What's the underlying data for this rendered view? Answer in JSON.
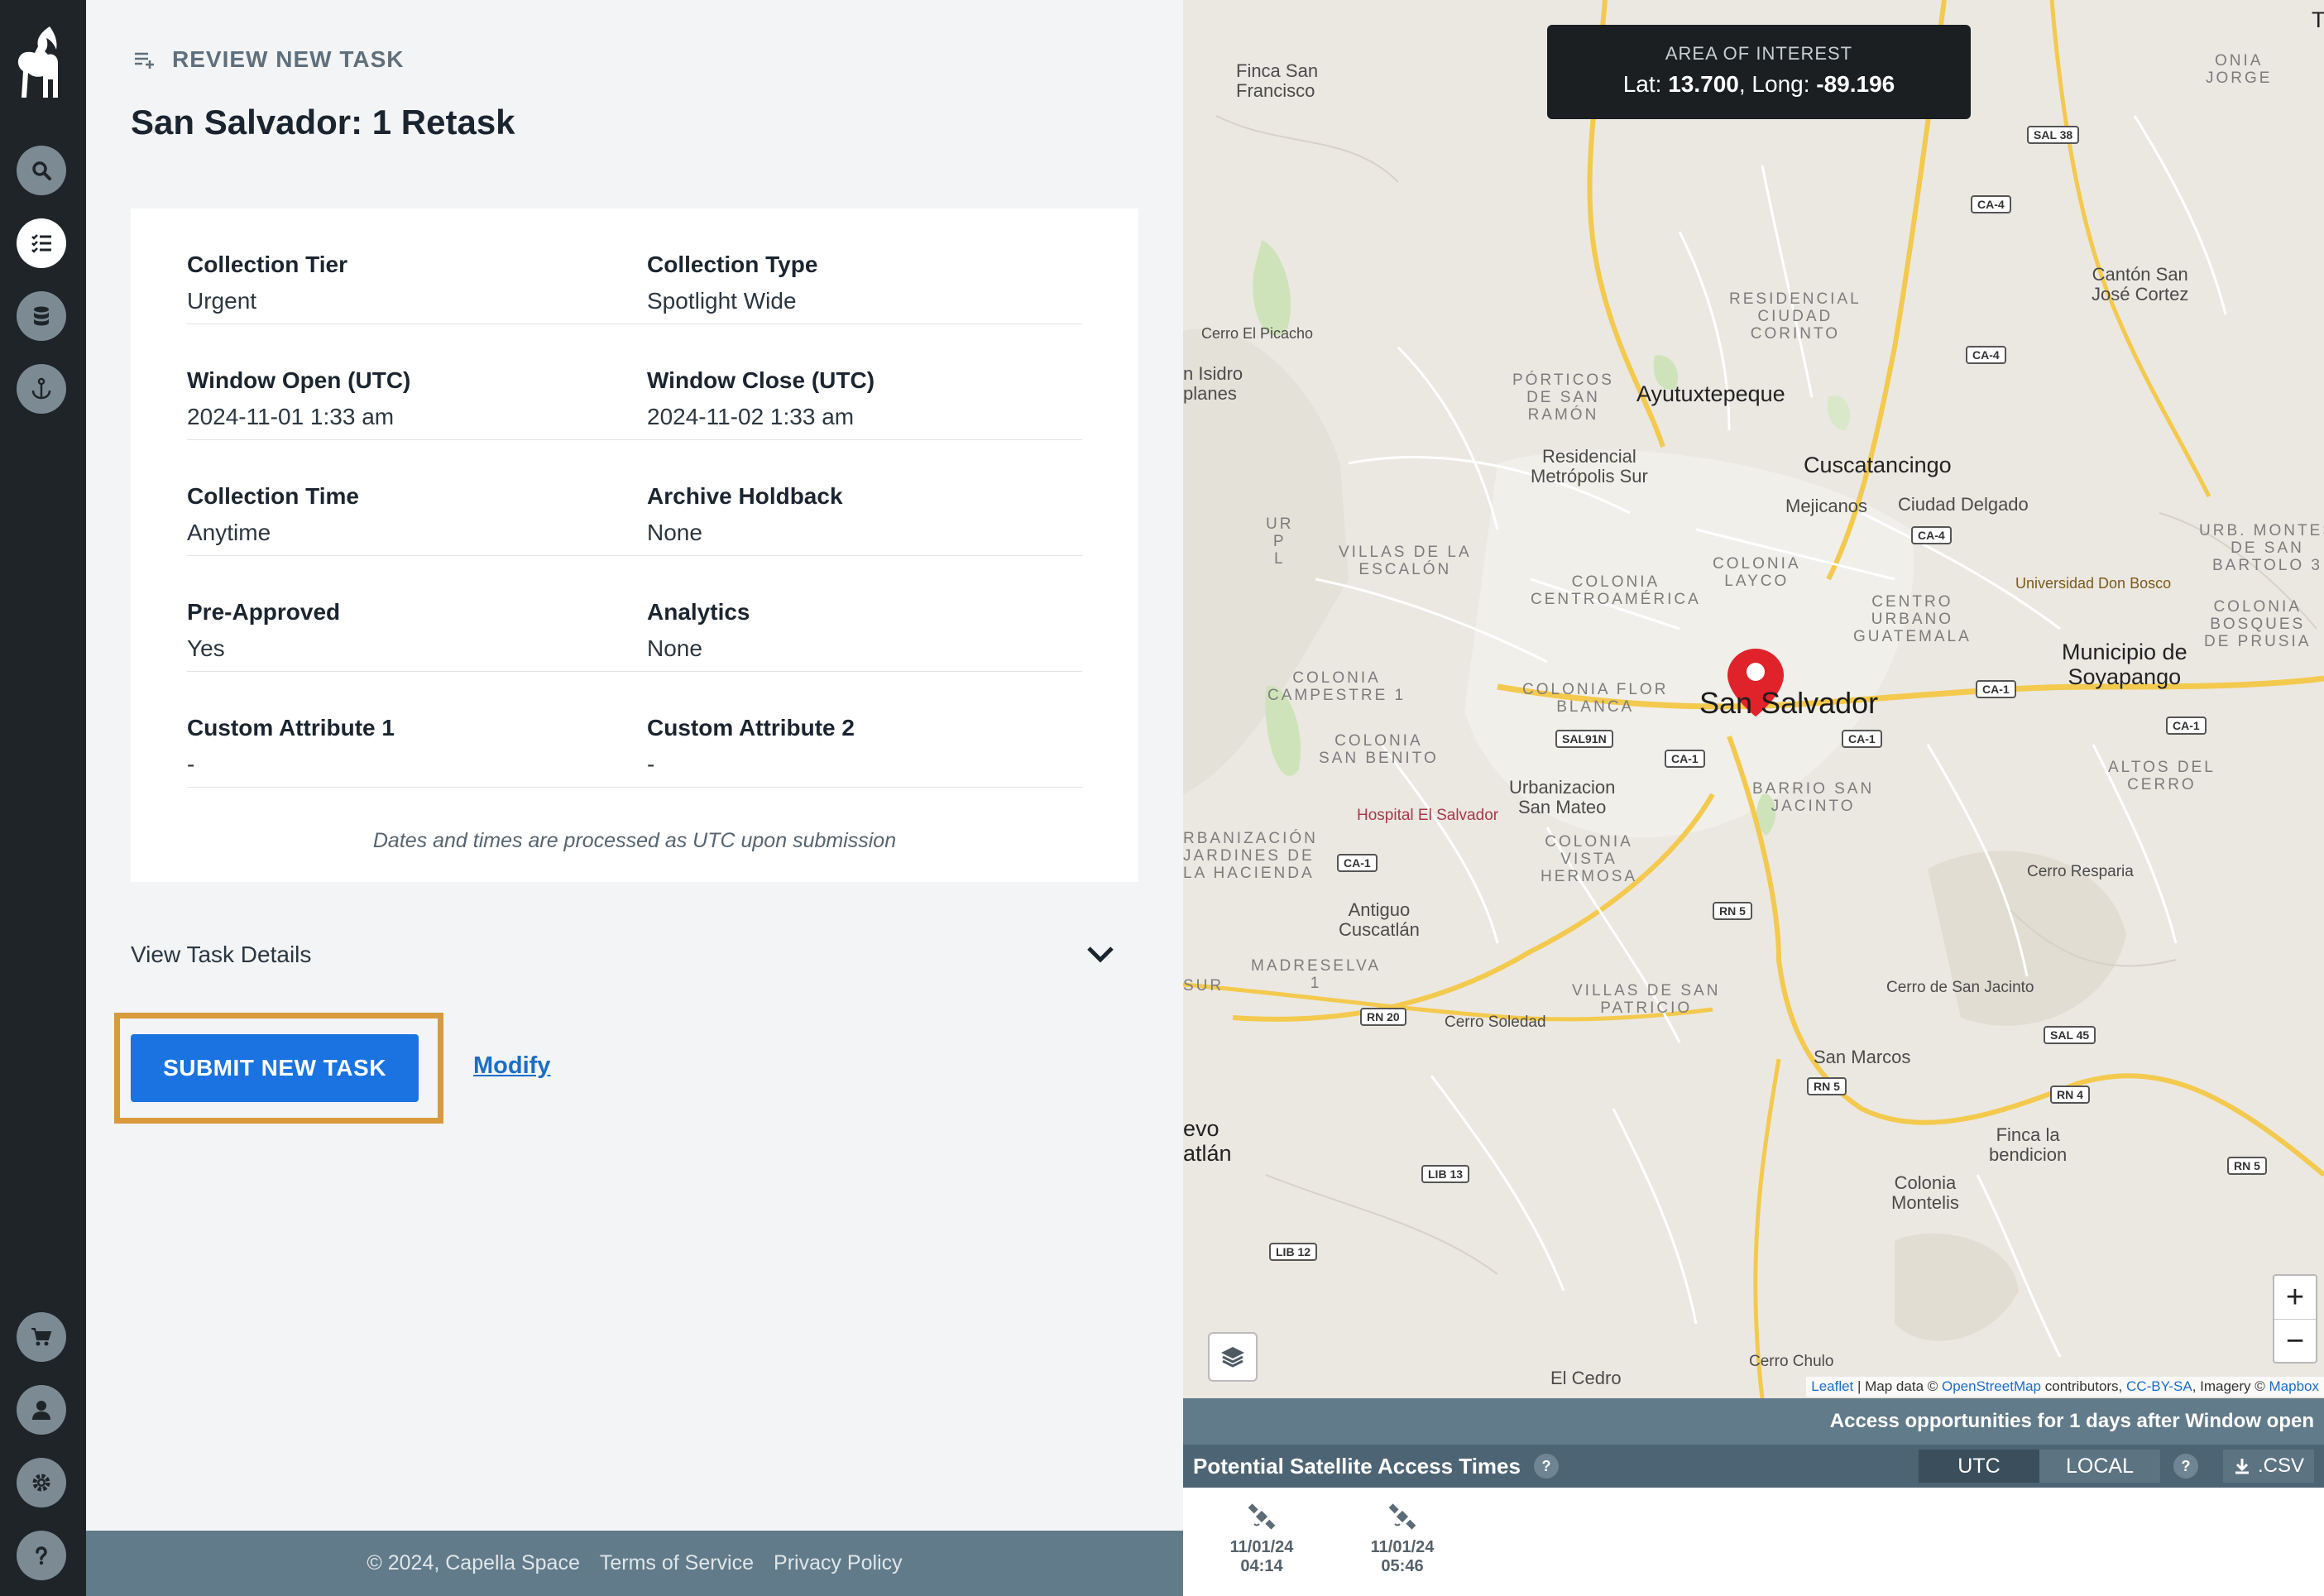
{
  "sidebar": {
    "items": [
      "search",
      "tasks",
      "database",
      "anchor",
      "cart",
      "user",
      "settings",
      "help"
    ]
  },
  "header": {
    "section_label": "REVIEW NEW TASK",
    "task_title": "San Salvador: 1 Retask"
  },
  "summary": {
    "rows": [
      {
        "left_label": "Collection Tier",
        "left_value": "Urgent",
        "right_label": "Collection Type",
        "right_value": "Spotlight Wide"
      },
      {
        "left_label": "Window Open (UTC)",
        "left_value": "2024-11-01 1:33 am",
        "right_label": "Window Close (UTC)",
        "right_value": "2024-11-02 1:33 am"
      },
      {
        "left_label": "Collection Time",
        "left_value": "Anytime",
        "right_label": "Archive Holdback",
        "right_value": "None"
      },
      {
        "left_label": "Pre-Approved",
        "left_value": "Yes",
        "right_label": "Analytics",
        "right_value": "None"
      },
      {
        "left_label": "Custom Attribute 1",
        "left_value": "-",
        "right_label": "Custom Attribute 2",
        "right_value": "-"
      }
    ],
    "note": "Dates and times are processed as UTC upon submission"
  },
  "details": {
    "label": "View Task Details"
  },
  "actions": {
    "submit_label": "SUBMIT NEW TASK",
    "modify_label": "Modify"
  },
  "footer": {
    "copyright": "© 2024, Capella Space",
    "terms": "Terms of Service",
    "privacy": "Privacy Policy"
  },
  "map": {
    "aoi_title": "AREA OF INTEREST",
    "lat_label": "Lat:",
    "lat_value": "13.700",
    "long_label": ", Long:",
    "long_value": "-89.196",
    "zoom_in": "+",
    "zoom_out": "−",
    "attribution": {
      "leaflet": "Leaflet",
      "sep1": " | Map data © ",
      "osm": "OpenStreetMap",
      "sep2": " contributors, ",
      "license": "CC-BY-SA",
      "sep3": ", Imagery © ",
      "mapbox": "Mapbox"
    },
    "labels": {
      "finca_san_francisco": "Finca San\nFrancisco",
      "cerro_picacho": "Cerro El Picacho",
      "isidro": "n Isidro\nplanes",
      "residencial_corinto": "RESIDENCIAL\nCIUDAD\nCORINTO",
      "porticos": "PÓRTICOS\nDE SAN\nRAMÓN",
      "ayutuxtepeque": "Ayutuxtepeque",
      "metropolis": "Residencial\nMetrópolis Sur",
      "cuscatancingo": "Cuscatancingo",
      "mejicanos": "Mejicanos",
      "ciudad_delgado": "Ciudad Delgado",
      "canton_san_jose": "Cantón San\nJosé Cortez",
      "villas_escalon": "VILLAS DE LA\nESCALÓN",
      "colonia_centroamerica": "COLONIA\nCENTROAMÉRICA",
      "colonia_layco": "COLONIA\nLAYCO",
      "centro_urbano": "CENTRO\nURBANO\nGUATEMALA",
      "universidad": "Universidad Don Bosco",
      "urb_montes": "URB. MONTES\nDE SAN\nBARTOLO 3",
      "colonia_bosques": "COLONIA\nBOSQUES\nDE PRUSIA",
      "soyapango": "Municipio de\nSoyapango",
      "campestre": "COLONIA\nCAMPESTRE 1",
      "flor_blanca": "COLONIA FLOR\nBLANCA",
      "san_salvador": "San Salvador",
      "san_benito": "COLONIA\nSAN BENITO",
      "urbanizacion_san_mateo": "Urbanizacion\nSan Mateo",
      "barrio_san_jacinto": "BARRIO SAN\nJACINTO",
      "hospital": "Hospital El Salvador",
      "altos_cerro": "ALTOS DEL\nCERRO",
      "jardines": "RBANIZACIÓN\nJARDINES DE\nLA HACIENDA",
      "colonia_vista": "COLONIA\nVISTA\nHERMOSA",
      "cerro_resparia": "Cerro Resparia",
      "antiguo_cuscatlan": "Antiguo\nCuscatlán",
      "madreselva": "MADRESELVA\n1",
      "cerro_san_jacinto": "Cerro de San Jacinto",
      "villas_patricio": "VILLAS DE SAN\nPATRICIO",
      "cerro_soledad": "Cerro Soledad",
      "san_marcos": "San Marcos",
      "nuevo_cuscatlan": "evo\natlán",
      "finca_bendicion": "Finca la\nbendicion",
      "colonia_montelis": "Colonia\nMontelis",
      "cerro_chulo": "Cerro Chulo",
      "el_cedro": "El Cedro",
      "onia_jorge": "ONIA\nJORGE",
      "ur_pl": "UR\nP\nL",
      "sur": "SUR",
      "t_edge": "T"
    },
    "shields": [
      "SAL 38",
      "CA-4",
      "CA-4",
      "CA-4",
      "CA-1",
      "SAL91N",
      "CA-1",
      "CA-1",
      "CA-1",
      "CA-1",
      "RN 5",
      "RN 20",
      "SAL 45",
      "RN 5",
      "RN 4",
      "RN 5",
      "LIB 13",
      "LIB 12"
    ]
  },
  "access": {
    "banner": "Access opportunities for 1 days after Window open",
    "title": "Potential Satellite Access Times",
    "help": "?",
    "tz_utc": "UTC",
    "tz_local": "LOCAL",
    "tz_help": "?",
    "csv": ".CSV",
    "passes": [
      {
        "date": "11/01/24",
        "time": "04:14"
      },
      {
        "date": "11/01/24",
        "time": "05:46"
      }
    ]
  },
  "colors": {
    "accent_blue": "#1a73e0",
    "highlight_orange": "#d89a3c",
    "rail": "#1e2428",
    "footer": "#627b8a",
    "marker_red": "#e0222b"
  }
}
